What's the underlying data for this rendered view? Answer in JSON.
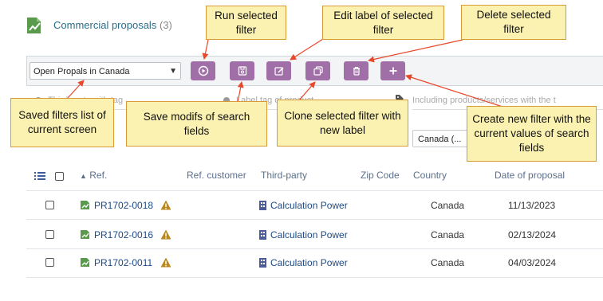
{
  "header": {
    "title": "Commercial proposals",
    "count": "(3)"
  },
  "filter_bar": {
    "selected_filter": "Open Propals in Canada",
    "buttons": [
      "run-selected-filter",
      "save-modifs",
      "edit-label",
      "clone-filter",
      "delete-filter",
      "create-new-filter"
    ]
  },
  "search_fields": {
    "thirdparty_placeholder": "Third-party with tag",
    "product_tag_placeholder": "Label tag of product",
    "products_placeholder": "Including products/services with the t",
    "country_value": "Canada (..."
  },
  "table": {
    "columns": {
      "ref": "Ref.",
      "ref_customer": "Ref. customer",
      "thirdparty": "Third-party",
      "zip": "Zip Code",
      "country": "Country",
      "date": "Date of proposal"
    },
    "rows": [
      {
        "ref": "PR1702-0018",
        "thirdparty": "Calculation Power",
        "country": "Canada",
        "date": "11/13/2023"
      },
      {
        "ref": "PR1702-0016",
        "thirdparty": "Calculation Power",
        "country": "Canada",
        "date": "02/13/2024"
      },
      {
        "ref": "PR1702-0011",
        "thirdparty": "Calculation Power",
        "country": "Canada",
        "date": "04/03/2024"
      }
    ]
  },
  "callouts": {
    "run": "Run selected filter",
    "edit": "Edit label of selected filter",
    "delete": "Delete selected filter",
    "saved": "Saved filters list of current screen",
    "save": "Save modifs of search fields",
    "clone": "Clone selected filter with new label",
    "create": "Create new filter with the current values of search fields"
  },
  "colors": {
    "button": "#a06fa8",
    "callout_bg": "#fbf2b1",
    "callout_border": "#d89a32",
    "link": "#1e4a84",
    "title": "#2a6f8a"
  }
}
